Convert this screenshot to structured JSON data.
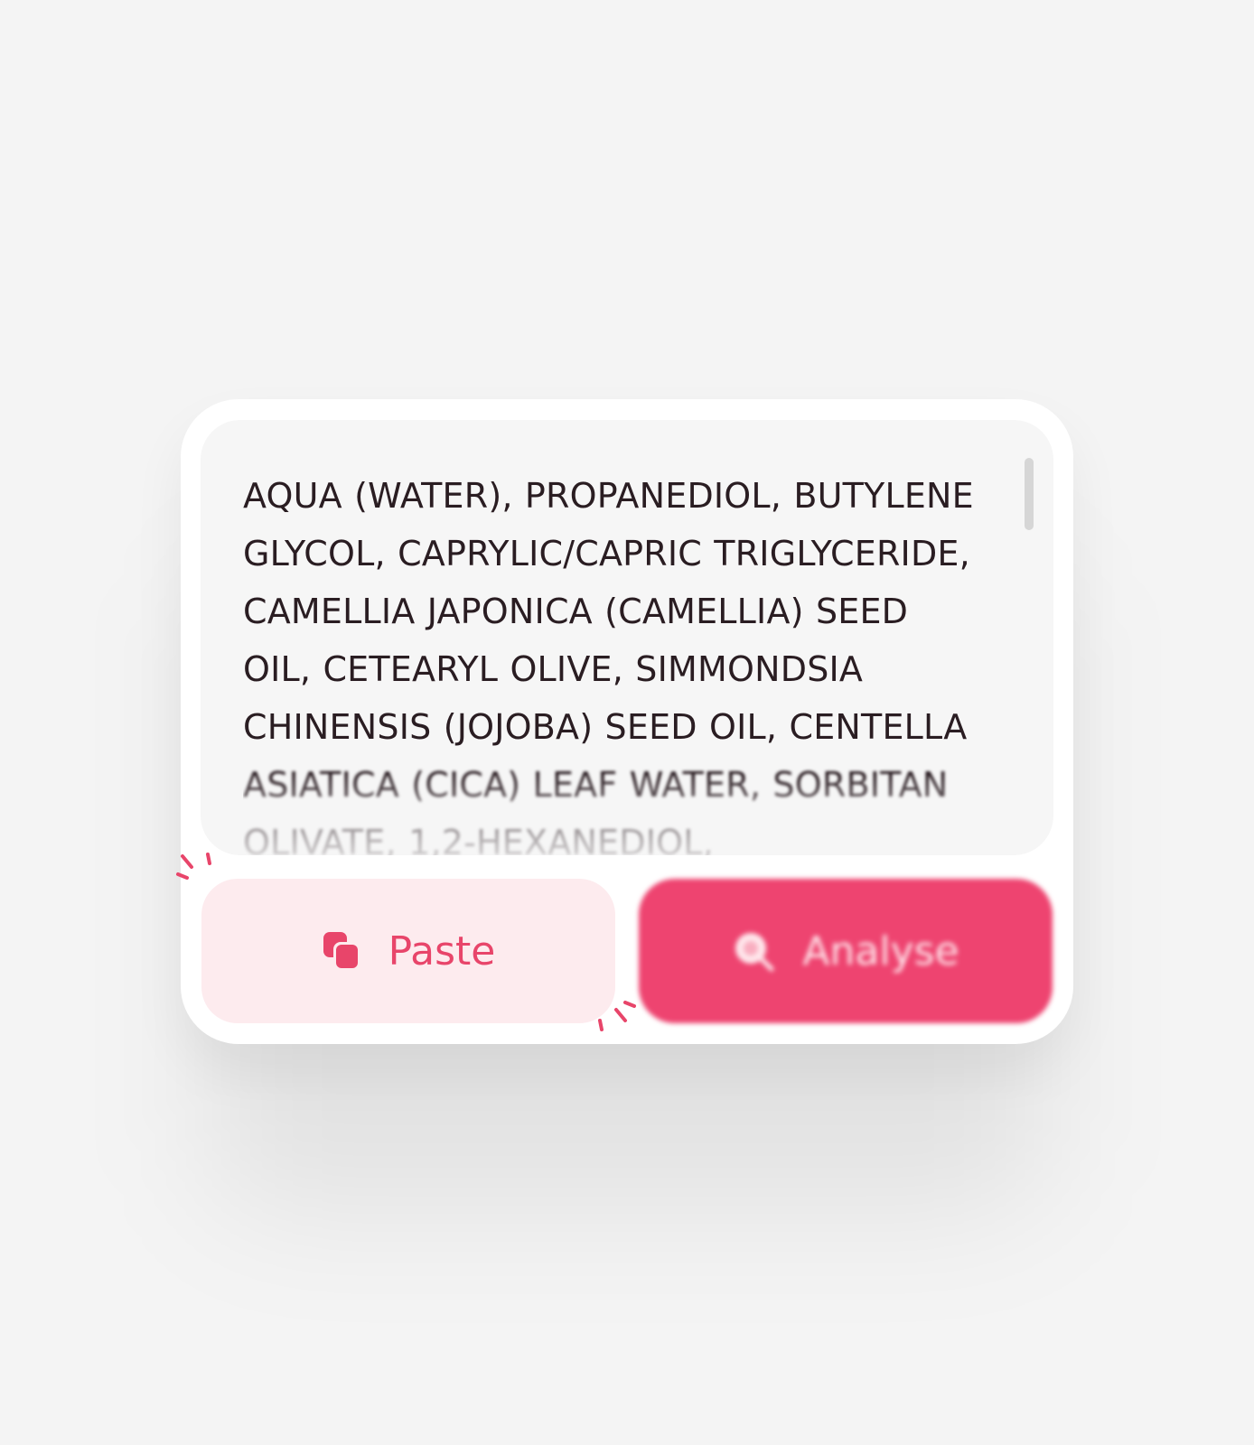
{
  "ingredients_field": {
    "lines_clear": [
      "AQUA (WATER), PROPANEDIOL, BUTYLENE",
      "GLYCOL, CAPRYLIC/CAPRIC TRIGLYCERIDE,",
      "CAMELLIA JAPONICA (CAMELLIA) SEED",
      "OIL, CETEARYL OLIVE, SIMMONDSIA",
      "CHINENSIS (JOJOBA) SEED OIL, CENTELLA"
    ],
    "lines_faded": [
      "ASIATICA (CICA) LEAF WATER, SORBITAN",
      "OLIVATE, 1,2-HEXANEDIOL,"
    ]
  },
  "buttons": {
    "paste_label": "Paste",
    "analyse_label": "Analyse"
  },
  "colors": {
    "accent": "#ee4470",
    "paste_bg": "#fdebee",
    "paste_text": "#e8456a",
    "field_bg": "#f6f6f6",
    "card_bg": "#ffffff",
    "page_bg": "#f4f4f4"
  },
  "icons": {
    "paste": "copy-icon",
    "analyse": "magnify-icon",
    "decoration": "spark-lines-icon"
  }
}
